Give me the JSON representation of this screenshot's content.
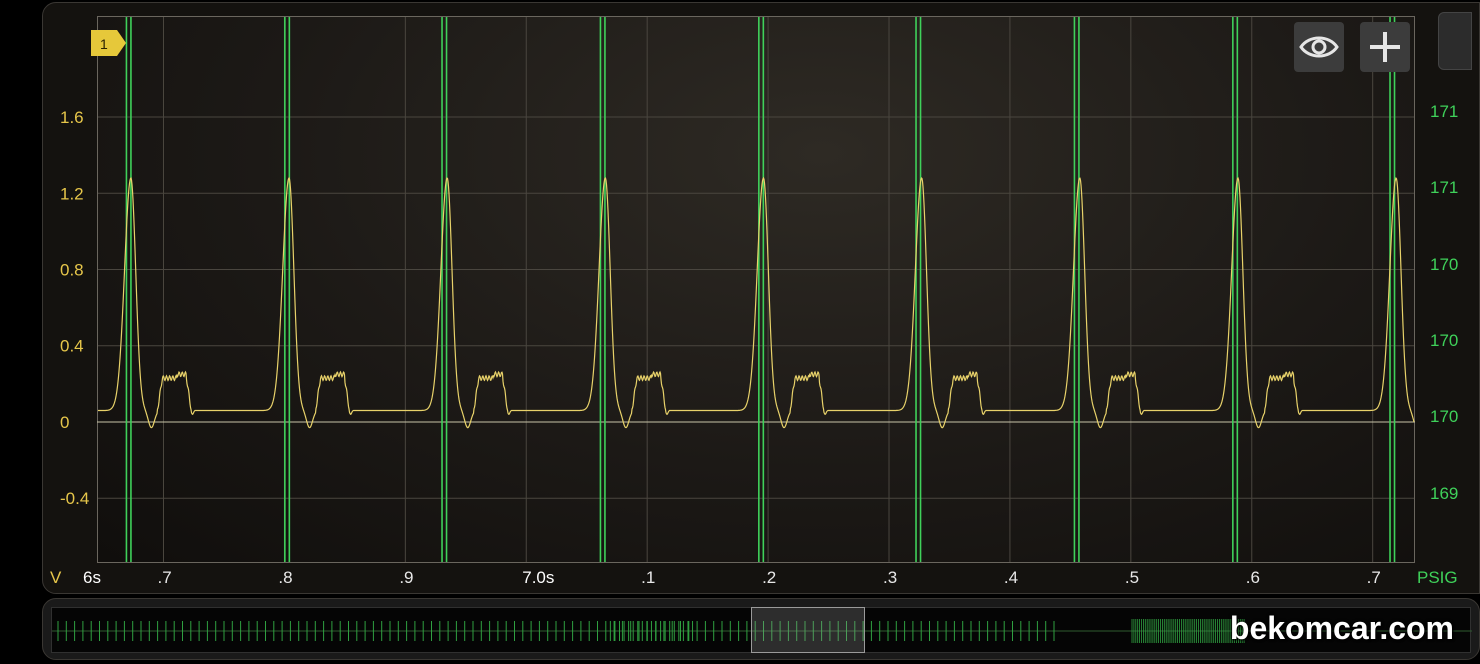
{
  "chart_data": {
    "type": "line",
    "title": "",
    "left_axis": {
      "unit": "V",
      "ticks": [
        "1.6",
        "1.2",
        "0.8",
        "0.4",
        "0",
        "-0.4"
      ],
      "tick_values": [
        1.6,
        1.2,
        0.8,
        0.4,
        0,
        -0.4
      ],
      "range": [
        -0.74,
        2.13
      ]
    },
    "right_axis": {
      "unit": "PSIG",
      "ticks": [
        "171",
        "171",
        "170",
        "170",
        "170",
        "170",
        "169"
      ]
    },
    "x_axis": {
      "range": [
        6.645,
        7.735
      ],
      "tick_labels": [
        {
          "t": 6.65,
          "label": "6s",
          "bold": true
        },
        {
          "t": 6.7,
          "label": ".7"
        },
        {
          "t": 6.8,
          "label": ".8"
        },
        {
          "t": 6.9,
          "label": ".9"
        },
        {
          "t": 7.0,
          "label": "7.0s",
          "bold": true
        },
        {
          "t": 7.1,
          "label": ".1"
        },
        {
          "t": 7.2,
          "label": ".2"
        },
        {
          "t": 7.3,
          "label": ".3"
        },
        {
          "t": 7.4,
          "label": ".4"
        },
        {
          "t": 7.5,
          "label": ".5"
        },
        {
          "t": 7.6,
          "label": ".6"
        },
        {
          "t": 7.7,
          "label": ".7"
        }
      ]
    },
    "channel_marker": "1",
    "series": [
      {
        "color": "#e8d26a",
        "axis": "left",
        "baseline": 0.06,
        "peak": 1.28,
        "plateau": 0.23,
        "peak_times": [
          6.673,
          6.804,
          6.934,
          7.065,
          7.196,
          7.326,
          7.457,
          7.588,
          7.718
        ],
        "period_s": 0.1308
      },
      {
        "color": "#3fd15a",
        "axis": "right",
        "pulse_times": [
          6.671,
          6.802,
          6.932,
          7.063,
          7.194,
          7.324,
          7.455,
          7.586,
          7.716
        ]
      }
    ],
    "grid": true
  },
  "toolbar": {
    "eye_icon": "eye-icon",
    "add_icon": "plus-icon"
  },
  "overview": {
    "window_label": ""
  },
  "watermark": "bekomcar.com"
}
